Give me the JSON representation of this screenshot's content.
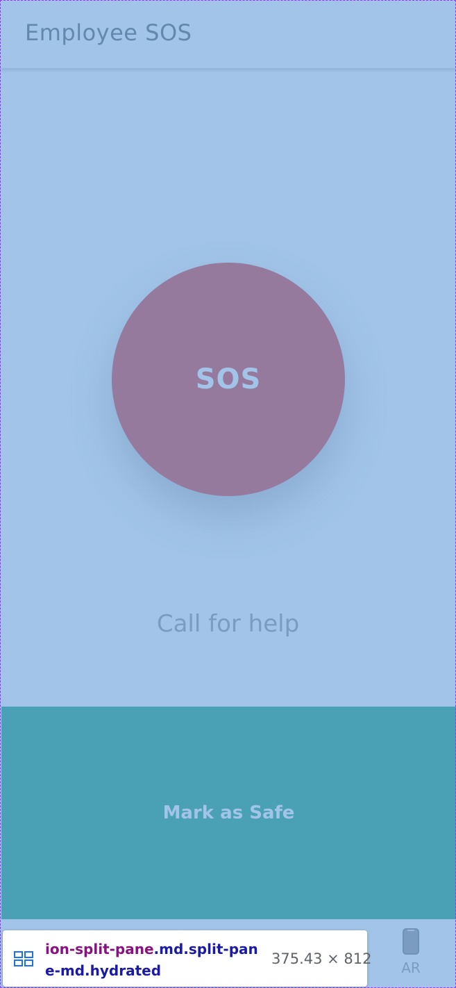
{
  "header": {
    "title": "Employee SOS"
  },
  "main": {
    "sos_button_label": "SOS",
    "call_for_help_text": "Call for help",
    "mark_safe_label": "Mark as Safe"
  },
  "devtools_tooltip": {
    "selector_tag": "ion-split-pane",
    "selector_classes": ".md.split-pane-md.hydrated",
    "dimensions": "375.43 × 812",
    "icon": "element-layout-icon"
  },
  "device_toggle": {
    "label": "AR",
    "icon": "phone-icon"
  },
  "colors": {
    "background": "#a1c4e8",
    "sos_button": "#967a9e",
    "safe_button": "#4aa1b6",
    "header_text": "#6388ad"
  }
}
